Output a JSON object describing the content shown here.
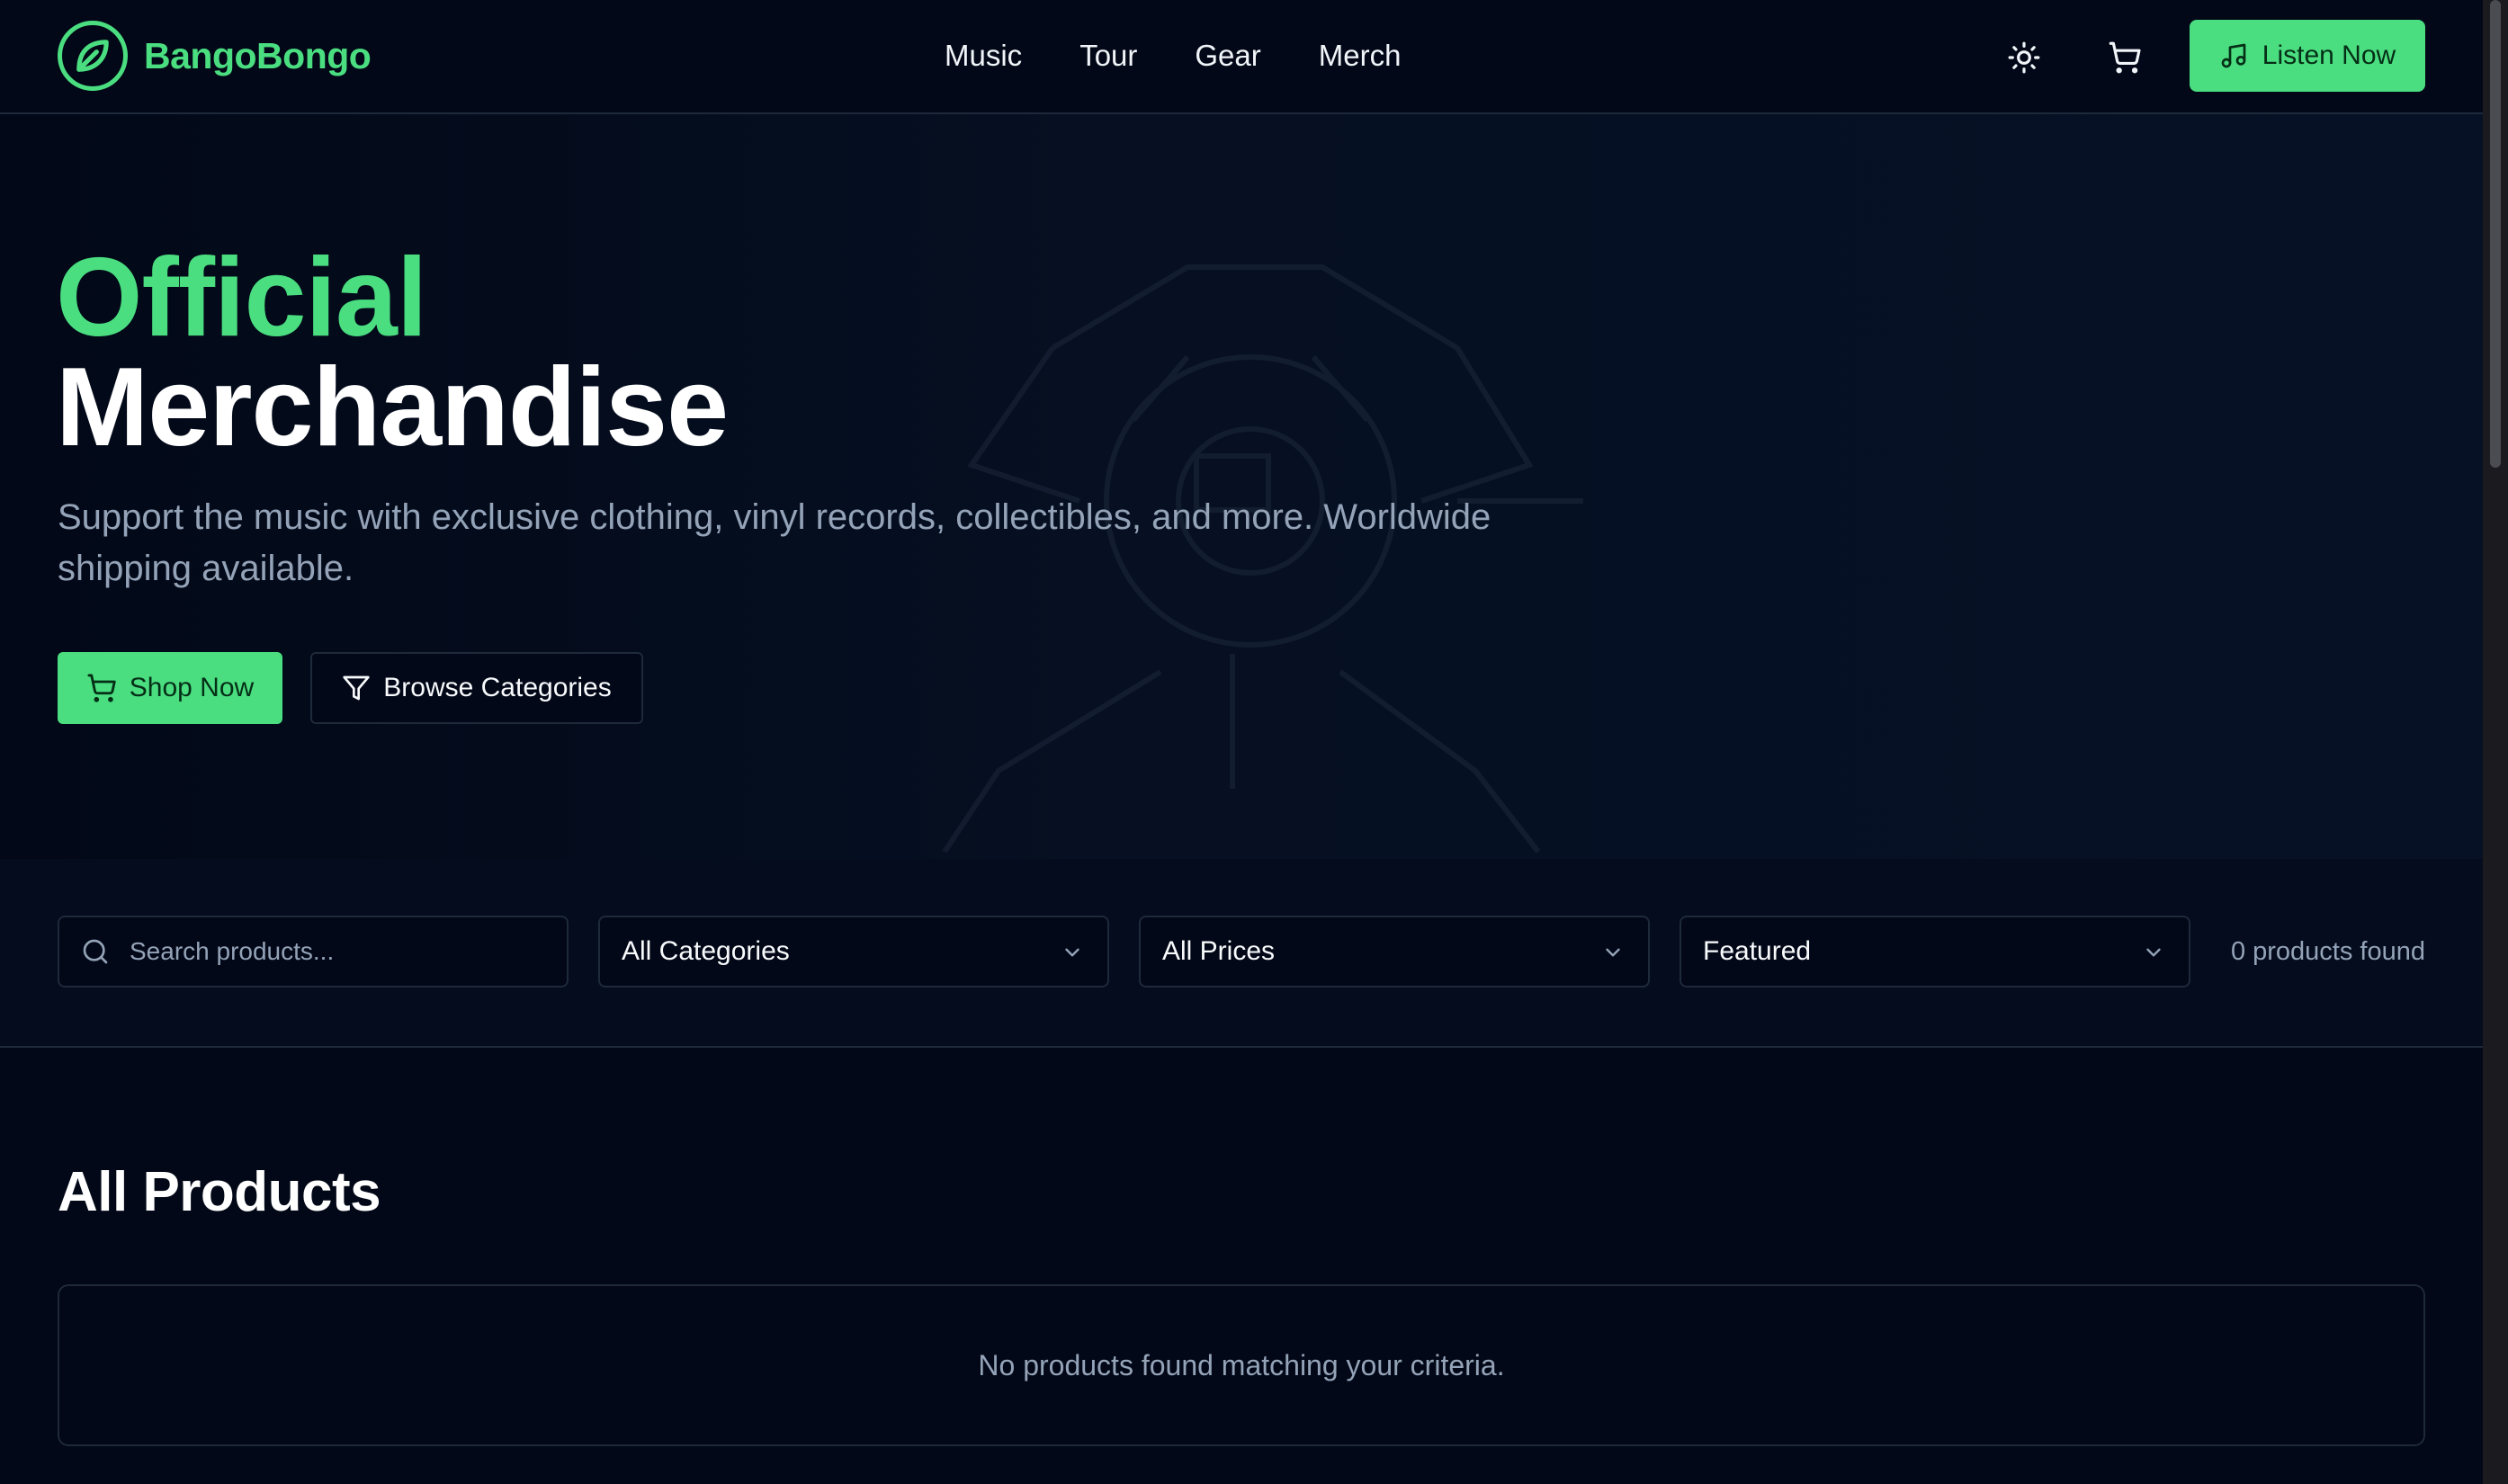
{
  "brand": {
    "name": "BangoBongo",
    "logo_icon": "leaf-circle-icon"
  },
  "nav": {
    "items": [
      {
        "label": "Music"
      },
      {
        "label": "Tour"
      },
      {
        "label": "Gear"
      },
      {
        "label": "Merch"
      }
    ]
  },
  "header": {
    "theme_icon": "sun-icon",
    "cart_icon": "cart-icon",
    "listen_button": {
      "label": "Listen Now",
      "icon": "music-note-icon"
    }
  },
  "hero": {
    "title_accent": "Official",
    "title_main": "Merchandise",
    "subtitle": "Support the music with exclusive clothing, vinyl records, collectibles, and more. Worldwide shipping available.",
    "shop_button": {
      "label": "Shop Now",
      "icon": "cart-icon"
    },
    "browse_button": {
      "label": "Browse Categories",
      "icon": "filter-icon"
    }
  },
  "filters": {
    "search": {
      "placeholder": "Search products...",
      "value": ""
    },
    "category": {
      "value": "All Categories"
    },
    "price": {
      "value": "All Prices"
    },
    "sort": {
      "value": "Featured"
    },
    "result_count": "0 products found"
  },
  "products": {
    "title": "All Products",
    "empty_message": "No products found matching your criteria."
  },
  "colors": {
    "accent": "#4ade80",
    "background": "#020817",
    "border": "#1e293b",
    "muted_text": "#94a3b8"
  }
}
